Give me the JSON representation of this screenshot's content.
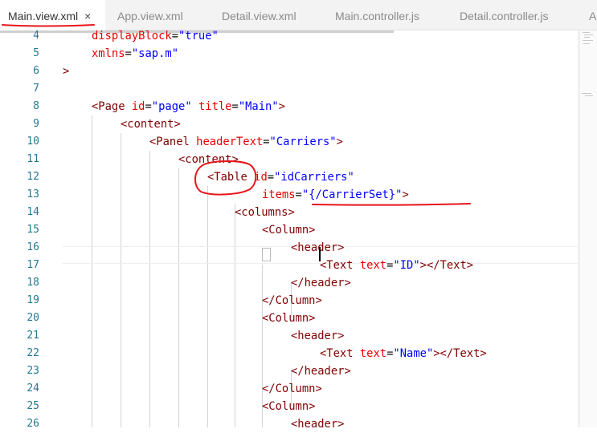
{
  "tabs": [
    {
      "label": "Main.view.xml",
      "active": true,
      "close": "×"
    },
    {
      "label": "App.view.xml",
      "active": false
    },
    {
      "label": "Detail.view.xml",
      "active": false
    },
    {
      "label": "Main.controller.js",
      "active": false
    },
    {
      "label": "Detail.controller.js",
      "active": false
    },
    {
      "label": "A",
      "active": false
    }
  ],
  "editor": {
    "line_numbers": [
      "4",
      "5",
      "6",
      "7",
      "8",
      "9",
      "10",
      "11",
      "12",
      "13",
      "14",
      "15",
      "16",
      "17",
      "18",
      "19",
      "20",
      "21",
      "22",
      "23",
      "24",
      "25",
      "26"
    ],
    "lines": {
      "l4": {
        "attr": "displayBlock",
        "eq": "=",
        "val": "\"true\""
      },
      "l5": {
        "attr": "xmlns",
        "eq": "=",
        "val": "\"sap.m\""
      },
      "l6": {
        "text": ">"
      },
      "l8": {
        "open": "<Page",
        "a1": "id",
        "v1": "\"page\"",
        "a2": "title",
        "v2": "\"Main\"",
        "close": ">"
      },
      "l9": {
        "tag": "<content>"
      },
      "l10": {
        "open": "<Panel",
        "a1": "headerText",
        "v1": "\"Carriers\"",
        "close": ">"
      },
      "l11": {
        "tag": "<content>"
      },
      "l12": {
        "open": "<Table",
        "a1": "id",
        "v1": "\"idCarriers\""
      },
      "l13": {
        "a1": "items",
        "v1": "\"{/CarrierSet}\"",
        "close": ">"
      },
      "l14": {
        "tag": "<columns>"
      },
      "l15": {
        "open": "<Column",
        "close": ">"
      },
      "l16": {
        "tag": "<header>"
      },
      "l17": {
        "open": "<Text",
        "a1": "text",
        "v1": "\"ID\"",
        "close": "></Text>"
      },
      "l18": {
        "tag": "</header>"
      },
      "l19": {
        "tag": "</Column>"
      },
      "l20": {
        "tag": "<Column>"
      },
      "l21": {
        "tag": "<header>"
      },
      "l22": {
        "open": "<Text",
        "a1": "text",
        "v1": "\"Name\"",
        "close": "></Text>"
      },
      "l23": {
        "tag": "</header>"
      },
      "l24": {
        "tag": "</Column>"
      },
      "l25": {
        "tag": "<Column>"
      },
      "l26": {
        "tag": "<header>"
      }
    }
  },
  "colors": {
    "tag": "#800000",
    "attribute": "#e50000",
    "value": "#0000ff",
    "line_number": "#237893",
    "annotation": "#e8151b"
  }
}
